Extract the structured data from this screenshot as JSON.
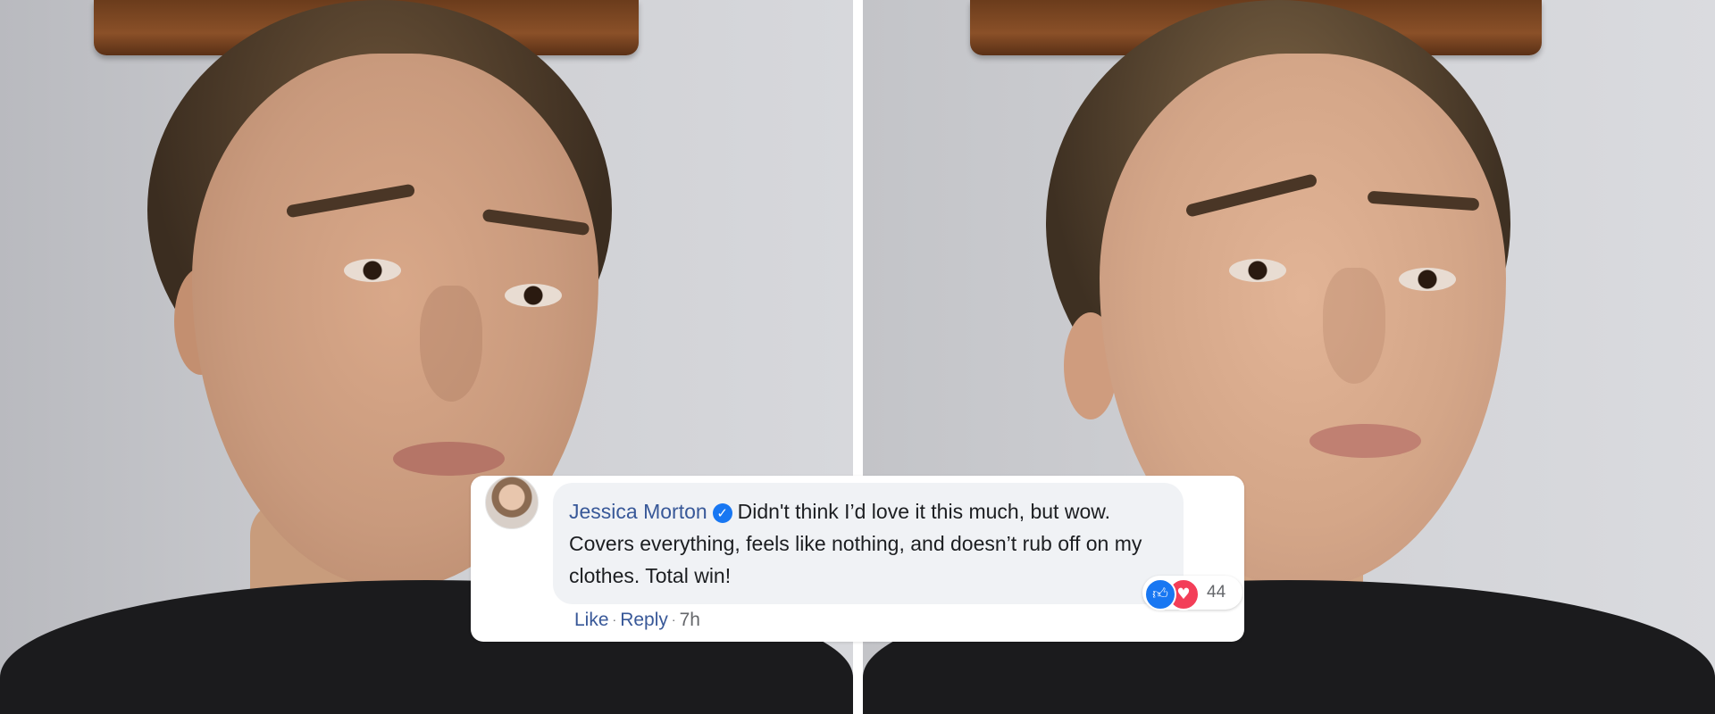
{
  "comment": {
    "author": "Jessica Morton",
    "verified_icon": "verified-badge-icon",
    "text": "Didn't think I’d love it this much, but wow. Covers everything, feels like nothing, and doesn’t rub off on my clothes. Total win!",
    "reactions": {
      "icons": [
        "like-icon",
        "love-icon"
      ],
      "count": "44"
    },
    "actions": {
      "like": "Like",
      "reply": "Reply",
      "time": "7h"
    }
  },
  "colors": {
    "bubble_bg": "#f0f2f5",
    "author_link": "#385898",
    "like_blue": "#1877f2",
    "love_red": "#f33e58",
    "meta_gray": "#65676b"
  }
}
